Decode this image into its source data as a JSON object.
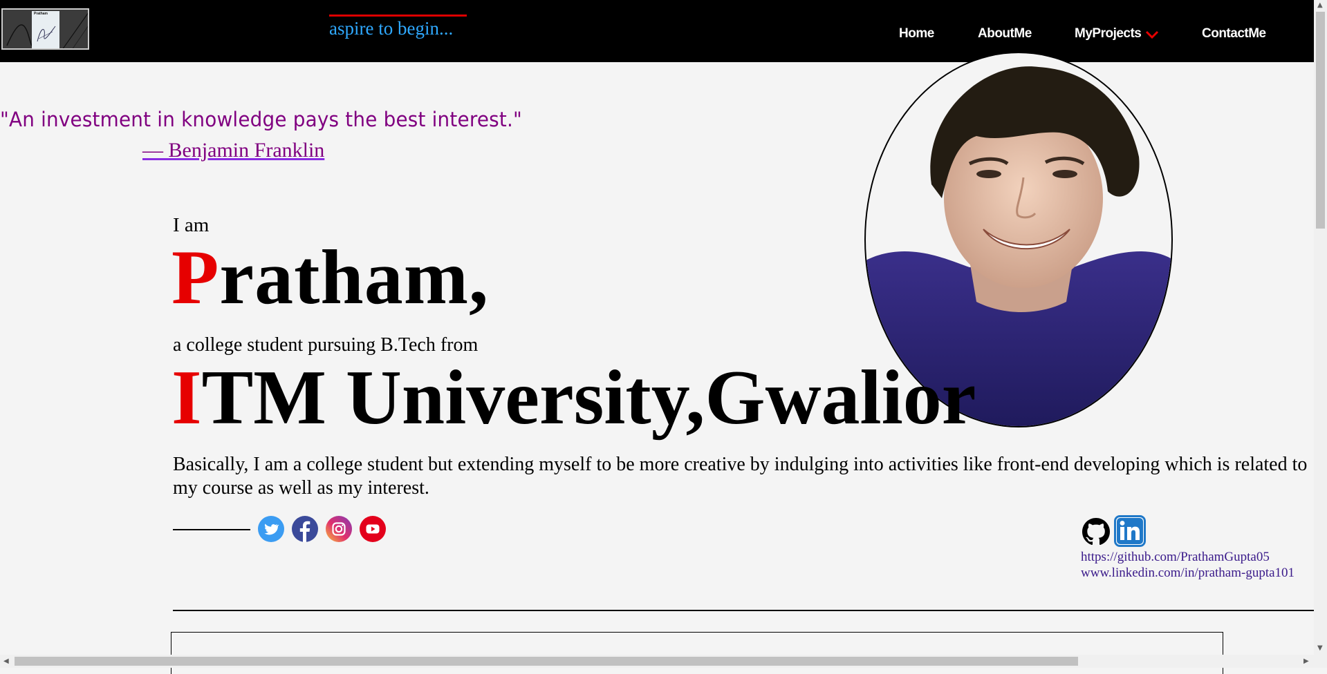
{
  "header": {
    "logo_text": "Pratham",
    "tagline": "aspire to begin...",
    "nav": [
      "Home",
      "AboutMe",
      "MyProjects",
      "ContactMe"
    ]
  },
  "quote": {
    "text": "\"An investment in knowledge pays the best interest.\"",
    "author": "— Benjamin Franklin"
  },
  "intro": {
    "iam": "I am",
    "name_first": "P",
    "name_rest": "ratham,",
    "subtitle": "a college student pursuing B.Tech from",
    "uni_first": "I",
    "uni_rest": "TM University,Gwalior",
    "bio": "Basically, I am a college student but extending myself to be more creative by indulging into activities like front-end developing which is related to my course as well as my interest."
  },
  "links": {
    "github": "https://github.com/PrathamGupta05",
    "linkedin": "www.linkedin.com/in/pratham-gupta101"
  },
  "colors": {
    "accent_red": "#e60000",
    "tagline": "#2fa9ff",
    "quote": "#800080"
  }
}
